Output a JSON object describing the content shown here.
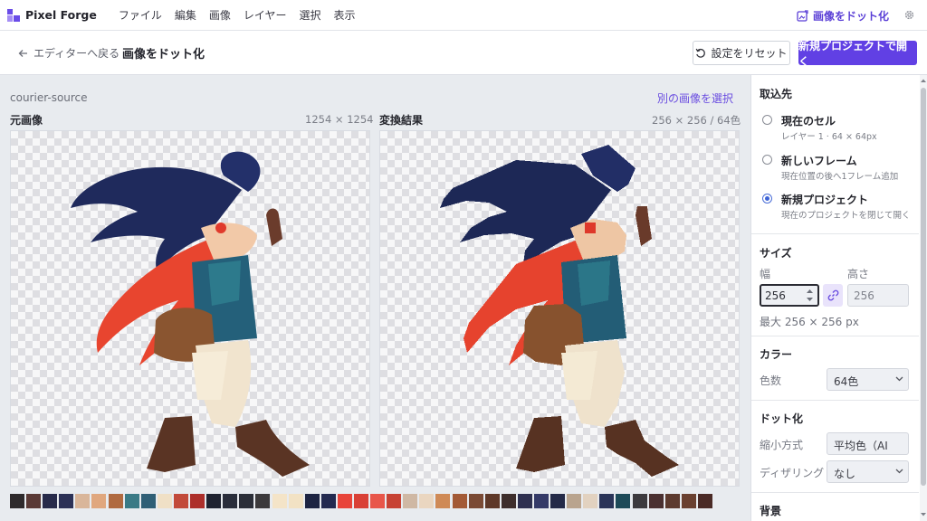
{
  "app": {
    "name": "Pixel Forge",
    "menu": [
      "ファイル",
      "編集",
      "画像",
      "レイヤー",
      "選択",
      "表示"
    ],
    "mode_label": "画像をドット化",
    "accent": "#6140e4"
  },
  "toolbar": {
    "back_label": "エディターへ戻る",
    "title": "画像をドット化",
    "reset_label": "設定をリセット",
    "open_label": "新規プロジェクトで開く"
  },
  "main": {
    "source_name": "courier-source",
    "select_other": "別の画像を選択",
    "original": {
      "title": "元画像",
      "dims": "1254 × 1254"
    },
    "result": {
      "title": "変換結果",
      "dims": "256 × 256 / 64色"
    }
  },
  "palette": [
    "#2e2a2c",
    "#5a3a36",
    "#272a4a",
    "#2c3156",
    "#d9b69a",
    "#e0a77e",
    "#b06a40",
    "#3a7a86",
    "#2f5f76",
    "#f0e0c6",
    "#c24a3a",
    "#ad2f2a",
    "#1f2330",
    "#2a2e3b",
    "#2b2e38",
    "#3c3a3c",
    "#f4e4c8",
    "#f2e2c4",
    "#1d2442",
    "#232a50",
    "#e8443a",
    "#d94036",
    "#e8564a",
    "#c74234",
    "#cfb8a4",
    "#ead6c0",
    "#cf8a56",
    "#a35a36",
    "#7a4a34",
    "#5e3828",
    "#3e2e2c",
    "#2e3050",
    "#343a68",
    "#242a48",
    "#b9a48e",
    "#e2d2c0",
    "#2a3458",
    "#1d4a58",
    "#3c3a3e",
    "#4a3030",
    "#5c3a2e",
    "#6a4030",
    "#4a2a26"
  ],
  "panel": {
    "target": {
      "title": "取込先",
      "options": [
        {
          "label": "現在のセル",
          "sub": "レイヤー 1 · 64 × 64px",
          "selected": false
        },
        {
          "label": "新しいフレーム",
          "sub": "現在位置の後へ1フレーム追加",
          "selected": false
        },
        {
          "label": "新規プロジェクト",
          "sub": "現在のプロジェクトを閉じて開く",
          "selected": true
        }
      ]
    },
    "size": {
      "title": "サイズ",
      "width_label": "幅",
      "height_label": "高さ",
      "width_value": "256",
      "height_value": "256",
      "max_text": "最大 256 × 256 px"
    },
    "color": {
      "title": "カラー",
      "count_label": "色数",
      "count_value": "64色"
    },
    "pixelate": {
      "title": "ドット化",
      "method_label": "縮小方式",
      "method_value": "平均色（AI",
      "dither_label": "ディザリング",
      "dither_value": "なし"
    },
    "background": {
      "title": "背景"
    }
  }
}
